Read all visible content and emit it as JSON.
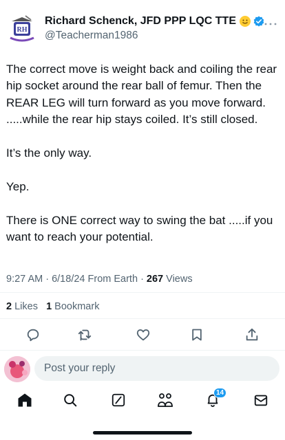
{
  "header": {
    "display_name": "Richard Schenck, JFD PPP LQC TTE",
    "handle": "@Teacherman1986",
    "avatar_icon": "profile-logo-icon",
    "badge_color": "#1d9bf0"
  },
  "tweet": {
    "paragraphs": [
      "The correct move is weight back and coiling the rear hip socket around the rear ball of femur. Then the REAR LEG will turn forward as you move forward. .....while the rear hip stays coiled. It’s still closed.",
      "It’s the only way.",
      "Yep.",
      "There is ONE correct way to swing the bat .....if you want to reach your potential."
    ],
    "time": "9:27 AM",
    "date": "6/18/24",
    "source": "From Earth",
    "views_count": "267",
    "views_label": "Views"
  },
  "stats": {
    "likes_count": "2",
    "likes_label": "Likes",
    "bookmarks_count": "1",
    "bookmarks_label": "Bookmark"
  },
  "reply": {
    "placeholder": "Post your reply"
  },
  "nav": {
    "notification_count": "14"
  },
  "colors": {
    "accent": "#1d9bf0",
    "text_primary": "#0f1419",
    "text_secondary": "#536471"
  }
}
